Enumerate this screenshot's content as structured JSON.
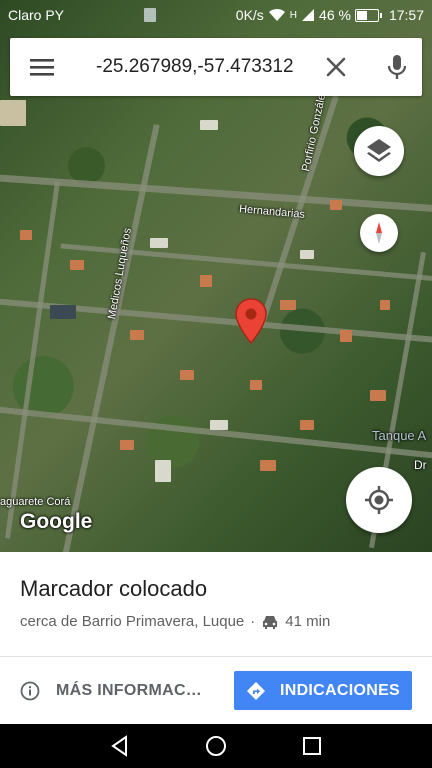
{
  "status_bar": {
    "carrier": "Claro PY",
    "speed": "0K/s",
    "signal": "H",
    "battery": "46 %",
    "battery_level": 0.46,
    "time": "17:57"
  },
  "search": {
    "query": "-25.267989,-57.473312",
    "icons": {
      "menu": "menu-icon",
      "close": "close-icon",
      "mic": "mic-icon"
    }
  },
  "map": {
    "labels": {
      "porfirio": "Porfirio Gonzále",
      "hernandarias": "Hernandarias",
      "medicos": "Medicos Luqueños",
      "tanque": "Tanque A",
      "dr": "Dr",
      "aguarete": "aguarete Corá"
    },
    "attribution": "Google",
    "controls": {
      "layers": "layers-icon",
      "compass": "compass-icon",
      "my_location": "my-location-icon"
    },
    "marker_color": "#ea4335"
  },
  "place_sheet": {
    "title": "Marcador colocado",
    "subtitle": "cerca de Barrio Primavera, Luque",
    "separator": "·",
    "drive_time": "41 min",
    "more_info_label": "MÁS INFORMAC…",
    "directions_label": "INDICACIONES",
    "accent": "#4285f4"
  },
  "nav_bar": {
    "back": "back-icon",
    "home": "home-icon",
    "recents": "recents-icon"
  }
}
